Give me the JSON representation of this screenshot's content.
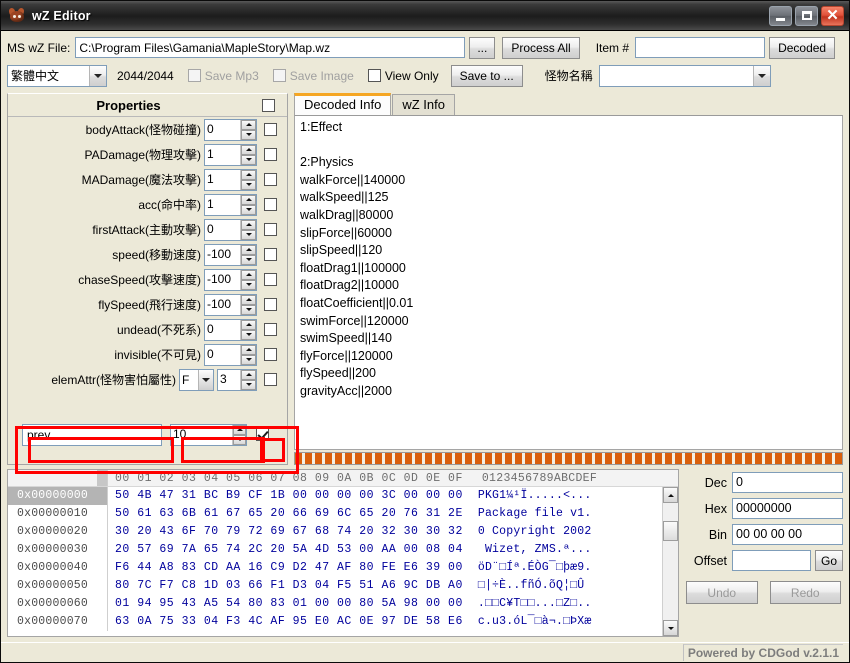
{
  "window": {
    "title": "wZ Editor",
    "icon": "mushroom-icon",
    "minimize_label": "",
    "maximize_label": "",
    "close_label": "✕"
  },
  "toolbar": {
    "file_label": "MS wZ File:",
    "file_path": "C:\\Program Files\\Gamania\\MapleStory\\Map.wz",
    "browse_label": "...",
    "process_all_label": "Process All",
    "item_label": "Item #",
    "item_value": "",
    "decoded_label": "Decoded",
    "language_value": "繁體中文",
    "counter": "2044/2044",
    "save_mp3_label": "Save Mp3",
    "save_image_label": "Save Image",
    "view_only_label": "View Only",
    "save_to_label": "Save to ...",
    "monster_name_label": "怪物名稱",
    "monster_name_value": ""
  },
  "properties": {
    "header": "Properties",
    "rows": [
      {
        "label": "bodyAttack(怪物碰撞)",
        "value": "0"
      },
      {
        "label": "PADamage(物理攻擊)",
        "value": "1"
      },
      {
        "label": "MADamage(魔法攻擊)",
        "value": "1"
      },
      {
        "label": "acc(命中率)",
        "value": "1"
      },
      {
        "label": "firstAttack(主動攻擊)",
        "value": "0"
      },
      {
        "label": "speed(移動速度)",
        "value": "-100"
      },
      {
        "label": "chaseSpeed(攻擊速度)",
        "value": "-100"
      },
      {
        "label": "flySpeed(飛行速度)",
        "value": "-100"
      },
      {
        "label": "undead(不死系)",
        "value": "0"
      },
      {
        "label": "invisible(不可見)",
        "value": "0"
      }
    ],
    "elem_attr": {
      "label": "elemAttr(怪物害怕屬性)",
      "select_value": "F",
      "value": "3"
    },
    "highlighted_row": {
      "name": "prev",
      "value": "10",
      "checked": true
    }
  },
  "info_panel": {
    "tabs": [
      {
        "label": "Decoded Info",
        "active": true
      },
      {
        "label": "wZ Info",
        "active": false
      }
    ],
    "lines": [
      "1:Effect",
      "",
      "2:Physics",
      "walkForce||140000",
      "walkSpeed||125",
      "walkDrag||80000",
      "slipForce||60000",
      "slipSpeed||120",
      "floatDrag1||100000",
      "floatDrag2||10000",
      "floatCoefficient||0.01",
      "swimForce||120000",
      "swimSpeed||140",
      "flyForce||120000",
      "flySpeed||200",
      "gravityAcc||2000"
    ]
  },
  "hex_viewer": {
    "column_headers": "00 01 02 03 04 05 06 07 08 09 0A 0B 0C 0D 0E 0F",
    "ascii_header": "0123456789ABCDEF",
    "rows": [
      {
        "offset": "0x00000000",
        "bytes": "50 4B 47 31 BC B9 CF 1B 00 00 00 00 3C 00 00 00",
        "ascii": "PKG1¼¹Ï.....<...",
        "selected": true
      },
      {
        "offset": "0x00000010",
        "bytes": "50 61 63 6B 61 67 65 20 66 69 6C 65 20 76 31 2E",
        "ascii": "Package file v1.",
        "selected": false
      },
      {
        "offset": "0x00000020",
        "bytes": "30 20 43 6F 70 79 72 69 67 68 74 20 32 30 30 32",
        "ascii": "0 Copyright 2002",
        "selected": false
      },
      {
        "offset": "0x00000030",
        "bytes": "20 57 69 7A 65 74 2C 20 5A 4D 53 00 AA 00 08 04",
        "ascii": " Wizet, ZMS.ª...",
        "selected": false
      },
      {
        "offset": "0x00000040",
        "bytes": "F6 44 A8 83 CD AA 16 C9 D2 47 AF 80 FE E6 39 00",
        "ascii": "öD¨□Íª.ÉÒG¯□þæ9.",
        "selected": false
      },
      {
        "offset": "0x00000050",
        "bytes": "80 7C F7 C8 1D 03 66 F1 D3 04 F5 51 A6 9C DB A0",
        "ascii": "□|÷È..fñÓ.õQ¦□Û ",
        "selected": false
      },
      {
        "offset": "0x00000060",
        "bytes": "01 94 95 43 A5 54 80 83 01 00 00 80 5A 98 00 00",
        "ascii": ".□□C¥T□□...□Z□..",
        "selected": false
      },
      {
        "offset": "0x00000070",
        "bytes": "63 0A 75 33 04 F3 4C AF 95 E0 AC 0E 97 DE 58 E6",
        "ascii": "c.u3.óL¯□à¬.□ÞXæ",
        "selected": false
      }
    ]
  },
  "inspector": {
    "dec_label": "Dec",
    "dec_value": "0",
    "hex_label": "Hex",
    "hex_value": "00000000",
    "bin_label": "Bin",
    "bin_value": "00 00 00 00",
    "offset_label": "Offset",
    "offset_value": "",
    "go_label": "Go",
    "undo_label": "Undo",
    "redo_label": "Redo"
  },
  "statusbar": {
    "powered_by": "Powered by CDGod v.2.1.1"
  },
  "colors": {
    "hex_text": "#00009c",
    "accent_tab": "#f5a623",
    "highlight_box": "#ff0000",
    "orange_bar": "#d9600c"
  }
}
